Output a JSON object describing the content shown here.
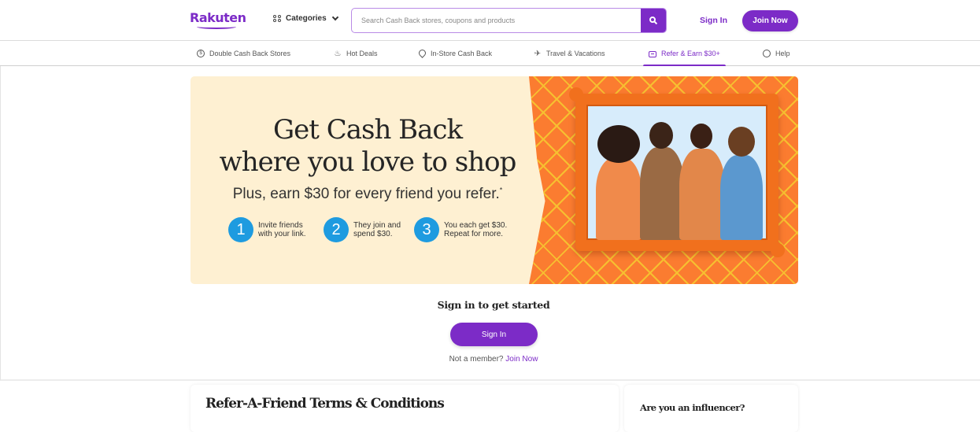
{
  "header": {
    "logo": "Rakuten",
    "categories_label": "Categories",
    "search_placeholder": "Search Cash Back stores, coupons and products",
    "search_value": "",
    "sign_in_label": "Sign In",
    "join_now_label": "Join Now"
  },
  "nav": {
    "items": [
      {
        "label": "Double Cash Back Stores",
        "icon": "dollar-circle-icon"
      },
      {
        "label": "Hot Deals",
        "icon": "flame-icon"
      },
      {
        "label": "In-Store Cash Back",
        "icon": "location-pin-icon"
      },
      {
        "label": "Travel & Vacations",
        "icon": "airplane-icon"
      },
      {
        "label": "Refer & Earn $30+",
        "icon": "chat-referral-icon",
        "active": true
      },
      {
        "label": "Help",
        "icon": "help-bubble-icon"
      }
    ]
  },
  "hero": {
    "title_line1": "Get Cash Back",
    "title_line2": "where you love to shop",
    "subtitle": "Plus, earn $30 for every friend you refer.",
    "subtitle_mark": "*",
    "steps": [
      {
        "number": "1",
        "text": "Invite friends\nwith your link."
      },
      {
        "number": "2",
        "text": "They join and\nspend $30."
      },
      {
        "number": "3",
        "text": "You each get $30.\nRepeat for more."
      }
    ],
    "image_alt": "Four smiling friends in an orange picture frame"
  },
  "cta": {
    "title": "Sign in to get started",
    "button_label": "Sign In",
    "member_prompt": "Not a member?",
    "join_link": "Join Now"
  },
  "terms": {
    "title": "Refer-A-Friend Terms & Conditions"
  },
  "influencer": {
    "title": "Are you an influencer?"
  },
  "colors": {
    "brand_purple": "#7c2bc7",
    "hero_cream": "#fef0d2",
    "hero_orange": "#fb7c30",
    "step_blue": "#1e9be0"
  }
}
